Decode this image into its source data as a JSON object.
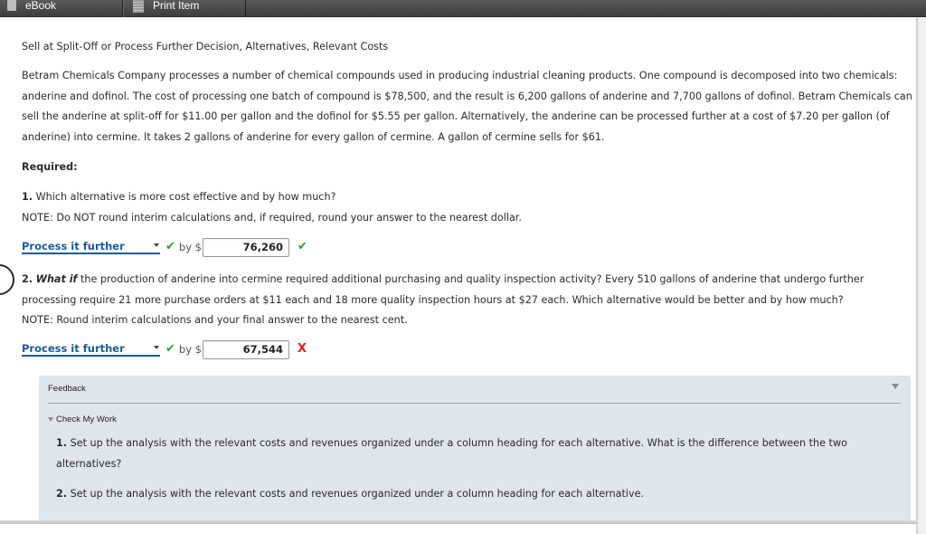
{
  "toolbar": {
    "ebook_label": "eBook",
    "print_label": "Print Item"
  },
  "problem": {
    "title": "Sell at Split-Off or Process Further Decision, Alternatives, Relevant Costs",
    "intro": "Betram Chemicals Company processes a number of chemical compounds used in producing industrial cleaning products. One compound is decomposed into two chemicals: anderine and dofinol. The cost of processing one batch of compound is $78,500, and the result is 6,200 gallons of anderine and 7,700 gallons of dofinol. Betram Chemicals can sell the anderine at split-off for $11.00 per gallon and the dofinol for $5.55 per gallon. Alternatively, the anderine can be processed further at a cost of $7.20 per gallon (of anderine) into cermine. It takes 2 gallons of anderine for every gallon of cermine. A gallon of cermine sells for $61.",
    "required_label": "Required:"
  },
  "questions": [
    {
      "number": "1.",
      "emphasis": "",
      "text": "Which alternative is more cost effective and by how much?",
      "note": "NOTE: Do NOT round interim calculations and, if required, round your answer to the nearest dollar.",
      "selected_option": "Process it further",
      "select_status": "correct",
      "by_label": "by $",
      "amount": "76,260",
      "amount_status": "correct"
    },
    {
      "number": "2.",
      "emphasis": "What if",
      "text": " the production of anderine into cermine required additional purchasing and quality inspection activity? Every 510 gallons of anderine that undergo further processing require 21 more purchase orders at $11 each and 18 more quality inspection hours at $27 each. Which alternative would be better and by how much?",
      "note": "NOTE: Round interim calculations and your final answer to the nearest cent.",
      "selected_option": "Process it further",
      "select_status": "correct",
      "by_label": "by $",
      "amount": "67,544",
      "amount_status": "incorrect"
    }
  ],
  "marks": {
    "correct_glyph": "✔",
    "incorrect_glyph": "X",
    "correct_color": "#2fa02f",
    "incorrect_color": "#e0211a"
  },
  "feedback": {
    "title": "Feedback",
    "check_my_work": "Check My Work",
    "items": [
      {
        "number": "1.",
        "text": "Set up the analysis with the relevant costs and revenues organized under a column heading for each alternative. What is the difference between the two alternatives?"
      },
      {
        "number": "2.",
        "text": "Set up the analysis with the relevant costs and revenues organized under a column heading for each alternative."
      }
    ]
  },
  "colors": {
    "link_blue": "#1c5a99",
    "feedback_bg": "#dfe6e9",
    "toolbar_bg": "#4a4a4a"
  }
}
